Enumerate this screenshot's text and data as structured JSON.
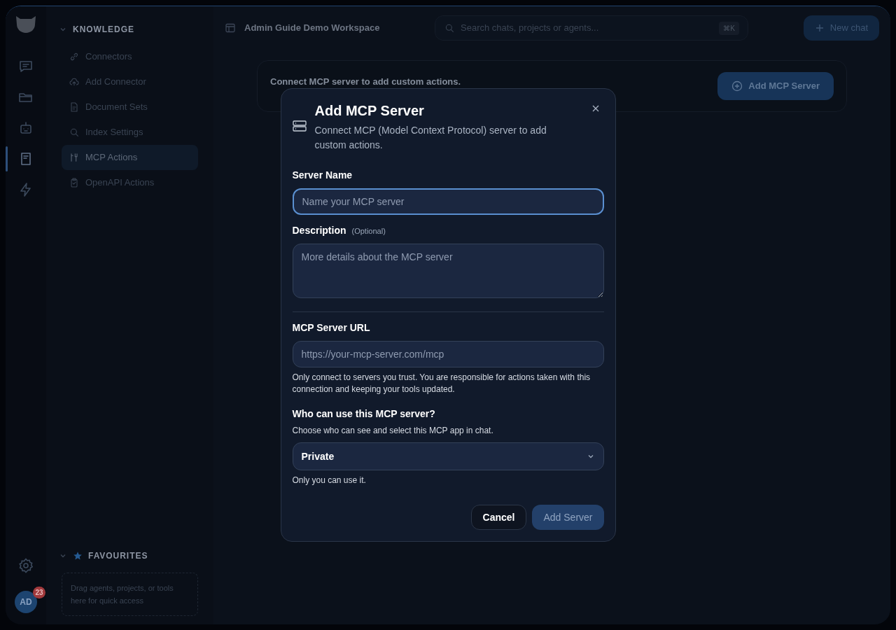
{
  "rail": {
    "items": [
      {
        "kind": "chat",
        "selected": false
      },
      {
        "kind": "folder",
        "selected": false
      },
      {
        "kind": "robot",
        "selected": false
      },
      {
        "kind": "book",
        "selected": true
      },
      {
        "kind": "bolt",
        "selected": false
      }
    ],
    "avatar": {
      "initials": "AD",
      "badge": "23"
    }
  },
  "sidebar": {
    "section": {
      "title": "KNOWLEDGE",
      "expanded": true,
      "items": [
        {
          "kind": "link",
          "label": "Connectors",
          "selected": false
        },
        {
          "kind": "cloud",
          "label": "Add Connector",
          "selected": false
        },
        {
          "kind": "doc",
          "label": "Document Sets",
          "selected": false
        },
        {
          "kind": "search",
          "label": "Index Settings",
          "selected": false
        },
        {
          "kind": "tools",
          "label": "MCP Actions",
          "selected": true
        },
        {
          "kind": "clipboard",
          "label": "OpenAPI Actions",
          "selected": false
        }
      ]
    },
    "favourites": {
      "title": "FAVOURITES",
      "expanded": true,
      "hint": "Drag agents, projects, or tools here for quick access"
    }
  },
  "topbar": {
    "workspace": "Admin Guide Demo Workspace",
    "search": {
      "placeholder": "Search chats, projects or agents...",
      "shortcut": "⌘K"
    },
    "new_chat": "New chat"
  },
  "page": {
    "banner": "Connect MCP server to add custom actions.",
    "button": "Add MCP Server"
  },
  "modal": {
    "title": "Add MCP Server",
    "subtitle": "Connect MCP (Model Context Protocol) server to add custom actions.",
    "fields": [
      {
        "kind": "input",
        "label": "Server Name",
        "placeholder": "Name your MCP server",
        "focused": true
      },
      {
        "kind": "textarea",
        "label": "Description",
        "optional": "(Optional)",
        "placeholder": "More details about the MCP server",
        "focused": false
      },
      {
        "kind": "divider"
      },
      {
        "kind": "input",
        "label": "MCP Server URL",
        "placeholder": "https://your-mcp-server.com/mcp",
        "help": "Only connect to servers you trust. You are responsible for actions taken with this connection and keeping your tools updated.",
        "focused": false
      },
      {
        "kind": "select",
        "label": "Who can use this MCP server?",
        "description": "Choose who can see and select this MCP app in chat.",
        "value": "Private",
        "help": "Only you can use it."
      }
    ],
    "buttons": [
      {
        "label": "Cancel",
        "primary": false,
        "disabled": false
      },
      {
        "label": "Add Server",
        "primary": true,
        "disabled": true
      }
    ]
  }
}
